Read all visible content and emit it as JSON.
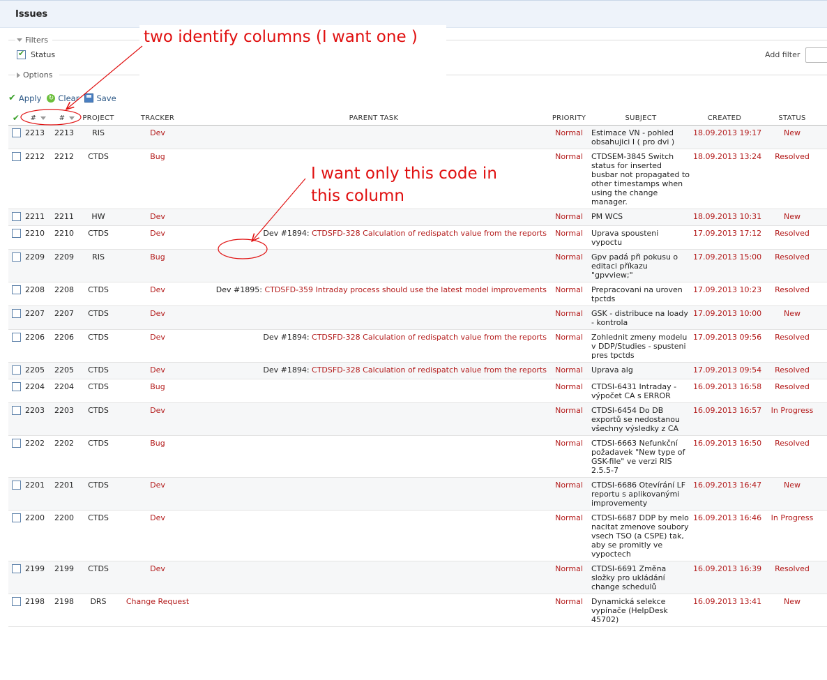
{
  "page": {
    "title": "Issues"
  },
  "filters": {
    "legend": "Filters",
    "status_label": "Status",
    "add_filter_label": "Add filter"
  },
  "options": {
    "legend": "Options"
  },
  "actions": {
    "apply": "Apply",
    "clear": "Clear",
    "save": "Save"
  },
  "annotations": {
    "columns_note": "two identify columns (I want one )",
    "code_note_line1": "I want only this code in",
    "code_note_line2": "this column",
    "color": "#e01010"
  },
  "columns": {
    "id1": "#",
    "id2": "#",
    "project": "PROJECT",
    "tracker": "TRACKER",
    "parent": "PARENT TASK",
    "priority": "PRIORITY",
    "subject": "SUBJECT",
    "created": "CREATED",
    "status": "STATUS"
  },
  "rows": [
    {
      "id": "2213",
      "id2": "2213",
      "project": "RIS",
      "tracker": "Dev",
      "parent_prefix": "",
      "parent_title": "",
      "priority": "Normal",
      "subject": "Estimace VN - pohled obsahujici I ( pro dvi )",
      "created": "18.09.2013 19:17",
      "status": "New"
    },
    {
      "id": "2212",
      "id2": "2212",
      "project": "CTDS",
      "tracker": "Bug",
      "parent_prefix": "",
      "parent_title": "",
      "priority": "Normal",
      "subject": "CTDSEM-3845 Switch status for inserted busbar not propagated to other timestamps when using the change manager.",
      "created": "18.09.2013 13:24",
      "status": "Resolved"
    },
    {
      "id": "2211",
      "id2": "2211",
      "project": "HW",
      "tracker": "Dev",
      "parent_prefix": "",
      "parent_title": "",
      "priority": "Normal",
      "subject": "PM WCS",
      "created": "18.09.2013 10:31",
      "status": "New"
    },
    {
      "id": "2210",
      "id2": "2210",
      "project": "CTDS",
      "tracker": "Dev",
      "parent_prefix": "Dev #1894:",
      "parent_title": "CTDSFD-328 Calculation of redispatch value from the reports",
      "priority": "Normal",
      "subject": "Uprava spousteni vypoctu",
      "created": "17.09.2013 17:12",
      "status": "Resolved"
    },
    {
      "id": "2209",
      "id2": "2209",
      "project": "RIS",
      "tracker": "Bug",
      "parent_prefix": "",
      "parent_title": "",
      "priority": "Normal",
      "subject": "Gpv padá při pokusu o editaci příkazu \"gpvview;\"",
      "created": "17.09.2013 15:00",
      "status": "Resolved"
    },
    {
      "id": "2208",
      "id2": "2208",
      "project": "CTDS",
      "tracker": "Dev",
      "parent_prefix": "Dev #1895:",
      "parent_title": "CTDSFD-359 Intraday process should use the latest model improvements",
      "priority": "Normal",
      "subject": "Prepracovani na uroven tpctds",
      "created": "17.09.2013 10:23",
      "status": "Resolved"
    },
    {
      "id": "2207",
      "id2": "2207",
      "project": "CTDS",
      "tracker": "Dev",
      "parent_prefix": "",
      "parent_title": "",
      "priority": "Normal",
      "subject": "GSK - distribuce na loady - kontrola",
      "created": "17.09.2013 10:00",
      "status": "New"
    },
    {
      "id": "2206",
      "id2": "2206",
      "project": "CTDS",
      "tracker": "Dev",
      "parent_prefix": "Dev #1894:",
      "parent_title": "CTDSFD-328 Calculation of redispatch value from the reports",
      "priority": "Normal",
      "subject": "Zohlednit zmeny modelu v DDP/Studies - spusteni pres tpctds",
      "created": "17.09.2013 09:56",
      "status": "Resolved"
    },
    {
      "id": "2205",
      "id2": "2205",
      "project": "CTDS",
      "tracker": "Dev",
      "parent_prefix": "Dev #1894:",
      "parent_title": "CTDSFD-328 Calculation of redispatch value from the reports",
      "priority": "Normal",
      "subject": "Uprava alg",
      "created": "17.09.2013 09:54",
      "status": "Resolved"
    },
    {
      "id": "2204",
      "id2": "2204",
      "project": "CTDS",
      "tracker": "Bug",
      "parent_prefix": "",
      "parent_title": "",
      "priority": "Normal",
      "subject": "CTDSI-6431 Intraday - výpočet CA s ERROR",
      "created": "16.09.2013 16:58",
      "status": "Resolved"
    },
    {
      "id": "2203",
      "id2": "2203",
      "project": "CTDS",
      "tracker": "Dev",
      "parent_prefix": "",
      "parent_title": "",
      "priority": "Normal",
      "subject": "CTDSI-6454 Do DB exportů se nedostanou všechny výsledky z CA",
      "created": "16.09.2013 16:57",
      "status": "In Progress"
    },
    {
      "id": "2202",
      "id2": "2202",
      "project": "CTDS",
      "tracker": "Bug",
      "parent_prefix": "",
      "parent_title": "",
      "priority": "Normal",
      "subject": "CTDSI-6663 Nefunkční požadavek \"New type of GSK-file\" ve verzi RIS 2.5.5-7",
      "created": "16.09.2013 16:50",
      "status": "Resolved"
    },
    {
      "id": "2201",
      "id2": "2201",
      "project": "CTDS",
      "tracker": "Dev",
      "parent_prefix": "",
      "parent_title": "",
      "priority": "Normal",
      "subject": "CTDSI-6686 Otevírání LF reportu s aplikovanými improvementy",
      "created": "16.09.2013 16:47",
      "status": "New"
    },
    {
      "id": "2200",
      "id2": "2200",
      "project": "CTDS",
      "tracker": "Dev",
      "parent_prefix": "",
      "parent_title": "",
      "priority": "Normal",
      "subject": "CTDSI-6687 DDP by melo nacitat zmenove soubory vsech TSO (a CSPE) tak, aby se promitly ve vypoctech",
      "created": "16.09.2013 16:46",
      "status": "In Progress"
    },
    {
      "id": "2199",
      "id2": "2199",
      "project": "CTDS",
      "tracker": "Dev",
      "parent_prefix": "",
      "parent_title": "",
      "priority": "Normal",
      "subject": "CTDSI-6691 Změna složky pro ukládání change schedulů",
      "created": "16.09.2013 16:39",
      "status": "Resolved"
    },
    {
      "id": "2198",
      "id2": "2198",
      "project": "DRS",
      "tracker": "Change Request",
      "parent_prefix": "",
      "parent_title": "",
      "priority": "Normal",
      "subject": "Dynamická selekce vypínače (HelpDesk 45702)",
      "created": "16.09.2013 13:41",
      "status": "New"
    }
  ]
}
